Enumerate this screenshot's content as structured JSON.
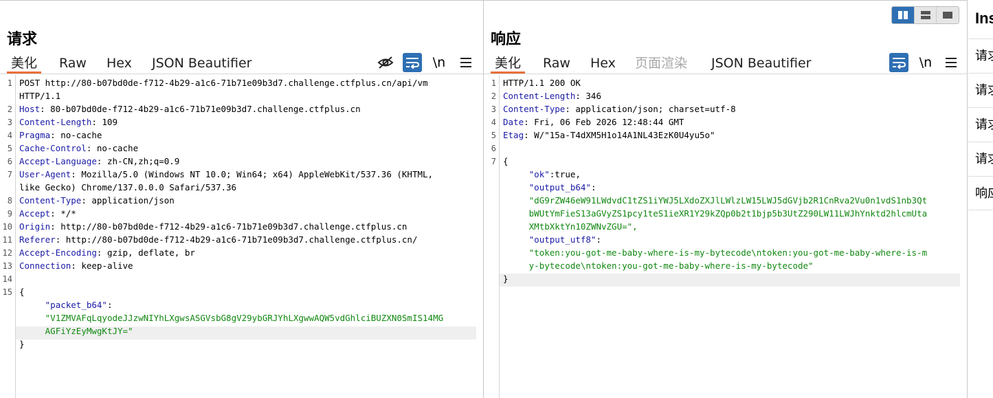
{
  "request": {
    "title": "请求",
    "tabs": [
      "美化",
      "Raw",
      "Hex",
      "JSON Beautifier"
    ],
    "active_tab": "美化",
    "newline_toggle": "\\n",
    "lines": [
      {
        "n": "1",
        "segs": [
          {
            "t": "POST http://80-b07bd0de-f712-4b29-a1c6-71b71e09b3d7.challenge.ctfplus.cn/api/vm",
            "c": ""
          }
        ]
      },
      {
        "n": "",
        "segs": [
          {
            "t": "HTTP/1.1",
            "c": ""
          }
        ]
      },
      {
        "n": "2",
        "segs": [
          {
            "t": "Host",
            "c": "hk"
          },
          {
            "t": ": 80-b07bd0de-f712-4b29-a1c6-71b71e09b3d7.challenge.ctfplus.cn",
            "c": ""
          }
        ]
      },
      {
        "n": "3",
        "segs": [
          {
            "t": "Content-Length",
            "c": "hk"
          },
          {
            "t": ": 109",
            "c": ""
          }
        ]
      },
      {
        "n": "4",
        "segs": [
          {
            "t": "Pragma",
            "c": "hk"
          },
          {
            "t": ": no-cache",
            "c": ""
          }
        ]
      },
      {
        "n": "5",
        "segs": [
          {
            "t": "Cache-Control",
            "c": "hk"
          },
          {
            "t": ": no-cache",
            "c": ""
          }
        ]
      },
      {
        "n": "6",
        "segs": [
          {
            "t": "Accept-Language",
            "c": "hk"
          },
          {
            "t": ": zh-CN,zh;q=0.9",
            "c": ""
          }
        ]
      },
      {
        "n": "7",
        "segs": [
          {
            "t": "User-Agent",
            "c": "hk"
          },
          {
            "t": ": Mozilla/5.0 (Windows NT 10.0; Win64; x64) AppleWebKit/537.36 (KHTML,",
            "c": ""
          }
        ]
      },
      {
        "n": "",
        "segs": [
          {
            "t": "like Gecko) Chrome/137.0.0.0 Safari/537.36",
            "c": ""
          }
        ]
      },
      {
        "n": "8",
        "segs": [
          {
            "t": "Content-Type",
            "c": "hk"
          },
          {
            "t": ": application/json",
            "c": ""
          }
        ]
      },
      {
        "n": "9",
        "segs": [
          {
            "t": "Accept",
            "c": "hk"
          },
          {
            "t": ": */*",
            "c": ""
          }
        ]
      },
      {
        "n": "10",
        "segs": [
          {
            "t": "Origin",
            "c": "hk"
          },
          {
            "t": ": http://80-b07bd0de-f712-4b29-a1c6-71b71e09b3d7.challenge.ctfplus.cn",
            "c": ""
          }
        ]
      },
      {
        "n": "11",
        "segs": [
          {
            "t": "Referer",
            "c": "hk"
          },
          {
            "t": ": http://80-b07bd0de-f712-4b29-a1c6-71b71e09b3d7.challenge.ctfplus.cn/",
            "c": ""
          }
        ]
      },
      {
        "n": "12",
        "segs": [
          {
            "t": "Accept-Encoding",
            "c": "hk"
          },
          {
            "t": ": gzip, deflate, br",
            "c": ""
          }
        ]
      },
      {
        "n": "13",
        "segs": [
          {
            "t": "Connection",
            "c": "hk"
          },
          {
            "t": ": keep-alive",
            "c": ""
          }
        ]
      },
      {
        "n": "14",
        "segs": []
      },
      {
        "n": "15",
        "segs": [
          {
            "t": "{",
            "c": ""
          }
        ]
      },
      {
        "n": "",
        "segs": [
          {
            "t": "     ",
            "c": ""
          },
          {
            "t": "\"packet_b64\"",
            "c": "key"
          },
          {
            "t": ":",
            "c": ""
          }
        ]
      },
      {
        "n": "",
        "segs": [
          {
            "t": "     ",
            "c": ""
          },
          {
            "t": "\"V1ZMVAFqLqyodeJJzwNIYhLXgwsASGVsbG8gV29ybGRJYhLXgwwAQW5vdGhlciBUZXN0SmIS14MG",
            "c": "str"
          }
        ]
      },
      {
        "n": "",
        "segs": [
          {
            "t": "     ",
            "c": ""
          },
          {
            "t": "AGFiYzEyMwgKtJY=\"",
            "c": "str"
          }
        ]
      },
      {
        "n": "",
        "segs": [
          {
            "t": "}",
            "c": ""
          }
        ]
      }
    ]
  },
  "response": {
    "title": "响应",
    "tabs": [
      "美化",
      "Raw",
      "Hex",
      "页面渲染",
      "JSON Beautifier"
    ],
    "active_tab": "美化",
    "disabled_tab": "页面渲染",
    "newline_toggle": "\\n",
    "lines": [
      {
        "n": "1",
        "segs": [
          {
            "t": "HTTP/1.1 200 OK",
            "c": ""
          }
        ]
      },
      {
        "n": "2",
        "segs": [
          {
            "t": "Content-Length",
            "c": "hk"
          },
          {
            "t": ": 346",
            "c": ""
          }
        ]
      },
      {
        "n": "3",
        "segs": [
          {
            "t": "Content-Type",
            "c": "hk"
          },
          {
            "t": ": application/json; charset=utf-8",
            "c": ""
          }
        ]
      },
      {
        "n": "4",
        "segs": [
          {
            "t": "Date",
            "c": "hk"
          },
          {
            "t": ": Fri, 06 Feb 2026 12:48:44 GMT",
            "c": ""
          }
        ]
      },
      {
        "n": "5",
        "segs": [
          {
            "t": "Etag",
            "c": "hk"
          },
          {
            "t": ": W/\"15a-T4dXM5H1o14A1NL43EzK0U4yu5o\"",
            "c": ""
          }
        ]
      },
      {
        "n": "6",
        "segs": []
      },
      {
        "n": "7",
        "segs": [
          {
            "t": "{",
            "c": ""
          }
        ]
      },
      {
        "n": "",
        "segs": [
          {
            "t": "     ",
            "c": ""
          },
          {
            "t": "\"ok\"",
            "c": "key"
          },
          {
            "t": ":true,",
            "c": ""
          }
        ]
      },
      {
        "n": "",
        "segs": [
          {
            "t": "     ",
            "c": ""
          },
          {
            "t": "\"output_b64\"",
            "c": "key"
          },
          {
            "t": ":",
            "c": ""
          }
        ]
      },
      {
        "n": "",
        "segs": [
          {
            "t": "     ",
            "c": ""
          },
          {
            "t": "\"dG9rZW46eW91LWdvdC1tZS1iYWJ5LXdoZXJlLWlzLW15LWJ5dGVjb2R1CnRva2Vu0n1vdS1nb3Qt",
            "c": "str"
          }
        ]
      },
      {
        "n": "",
        "segs": [
          {
            "t": "     ",
            "c": ""
          },
          {
            "t": "bWUtYmFieS13aGVyZS1pcy1teS1ieXR1Y29kZQp0b2t1bjp5b3UtZ290LW11LWJhYnktd2hlcmUta",
            "c": "str"
          }
        ]
      },
      {
        "n": "",
        "segs": [
          {
            "t": "     ",
            "c": ""
          },
          {
            "t": "XMtbXktYn10ZWNvZGU=\",",
            "c": "str"
          }
        ]
      },
      {
        "n": "",
        "segs": [
          {
            "t": "     ",
            "c": ""
          },
          {
            "t": "\"output_utf8\"",
            "c": "key"
          },
          {
            "t": ":",
            "c": ""
          }
        ]
      },
      {
        "n": "",
        "segs": [
          {
            "t": "     ",
            "c": ""
          },
          {
            "t": "\"token:you-got-me-baby-where-is-my-bytecode\\ntoken:you-got-me-baby-where-is-m",
            "c": "str"
          }
        ]
      },
      {
        "n": "",
        "segs": [
          {
            "t": "     ",
            "c": ""
          },
          {
            "t": "y-bytecode\\ntoken:you-got-me-baby-where-is-my-bytecode\"",
            "c": "str"
          }
        ]
      },
      {
        "n": "",
        "segs": [
          {
            "t": "}",
            "c": ""
          }
        ]
      }
    ]
  },
  "inspector": {
    "title": "Ins",
    "items": [
      "请求",
      "请求",
      "请求",
      "请求",
      "响应"
    ]
  },
  "colors": {
    "accent": "#2e6fb3",
    "tab_underline": "#e8703a",
    "header_key": "#1a1aa6",
    "json_string": "#118811"
  }
}
